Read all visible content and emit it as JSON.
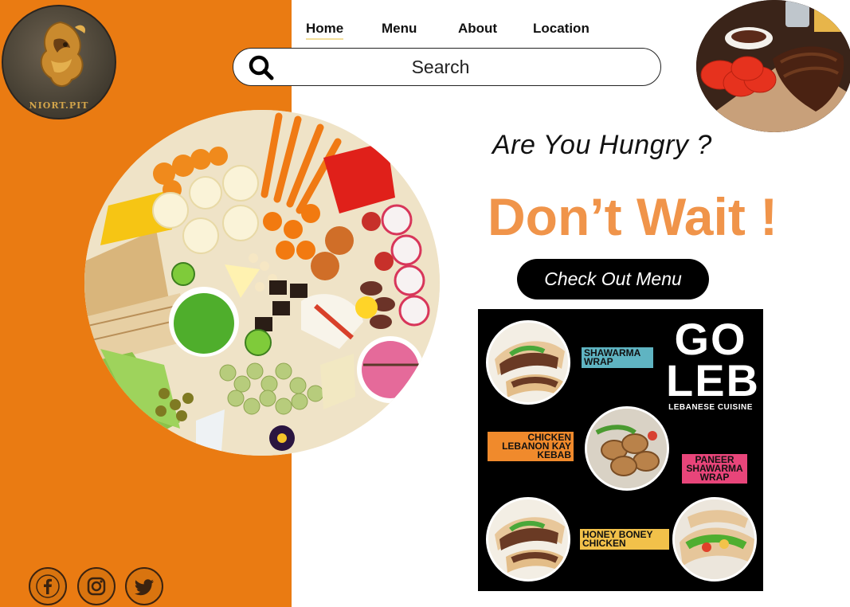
{
  "brand": {
    "logo_text": "NIORT.PIT"
  },
  "nav": {
    "items": [
      {
        "label": "Home",
        "active": true
      },
      {
        "label": "Menu",
        "active": false
      },
      {
        "label": "About",
        "active": false
      },
      {
        "label": "Location",
        "active": false
      }
    ]
  },
  "search": {
    "placeholder": "Search"
  },
  "hero": {
    "tagline": "Are You Hungry ?",
    "headline": "Don’t Wait !",
    "cta_label": "Check Out Menu"
  },
  "menu_card": {
    "brand_top": "GO",
    "brand_bottom": "LEB",
    "subtitle": "LEBANESE CUISINE",
    "items": [
      {
        "name": "SHAWARMA WRAP",
        "tag_color": "#5fb4c2"
      },
      {
        "name": "CHICKEN LEBANON KAY KEBAB",
        "tag_color": "#f08a2c"
      },
      {
        "name": "PANEER SHAWARMA WRAP",
        "tag_color": "#e8457a"
      },
      {
        "name": "HONEY BONEY CHICKEN",
        "tag_color": "#f2c14a"
      }
    ]
  },
  "social": [
    "facebook-icon",
    "instagram-icon",
    "twitter-icon"
  ],
  "colors": {
    "accent": "#ea7b12",
    "headline": "#f0944a",
    "cta_bg": "#000000"
  }
}
